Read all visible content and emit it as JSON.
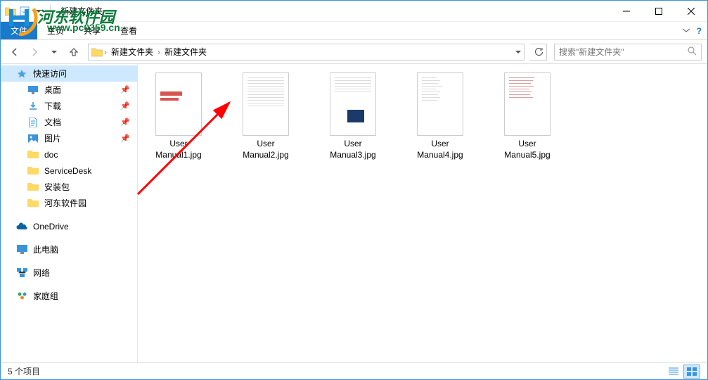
{
  "window": {
    "title": "新建文件夹"
  },
  "ribbon": {
    "file": "文件",
    "tabs": [
      "主页",
      "共享",
      "查看"
    ]
  },
  "nav": {
    "breadcrumb": [
      "新建文件夹",
      "新建文件夹"
    ],
    "search_placeholder": "搜索\"新建文件夹\""
  },
  "sidebar": {
    "quick_access": "快速访问",
    "pinned": [
      {
        "label": "桌面",
        "icon": "desktop"
      },
      {
        "label": "下载",
        "icon": "downloads"
      },
      {
        "label": "文档",
        "icon": "documents"
      },
      {
        "label": "图片",
        "icon": "pictures"
      }
    ],
    "folders": [
      {
        "label": "doc"
      },
      {
        "label": "ServiceDesk"
      },
      {
        "label": "安装包"
      },
      {
        "label": "河东软件园"
      }
    ],
    "onedrive": "OneDrive",
    "thispc": "此电脑",
    "network": "网络",
    "homegroup": "家庭组"
  },
  "files": [
    {
      "name": "User Manual1.jpg",
      "style": "red"
    },
    {
      "name": "User Manual2.jpg",
      "style": "text"
    },
    {
      "name": "User Manual3.jpg",
      "style": "box"
    },
    {
      "name": "User Manual4.jpg",
      "style": "list"
    },
    {
      "name": "User Manual5.jpg",
      "style": "list2"
    }
  ],
  "status": {
    "count": "5 个项目"
  },
  "watermark": {
    "text": "河东软件园",
    "url": "www.pc0359.cn"
  }
}
